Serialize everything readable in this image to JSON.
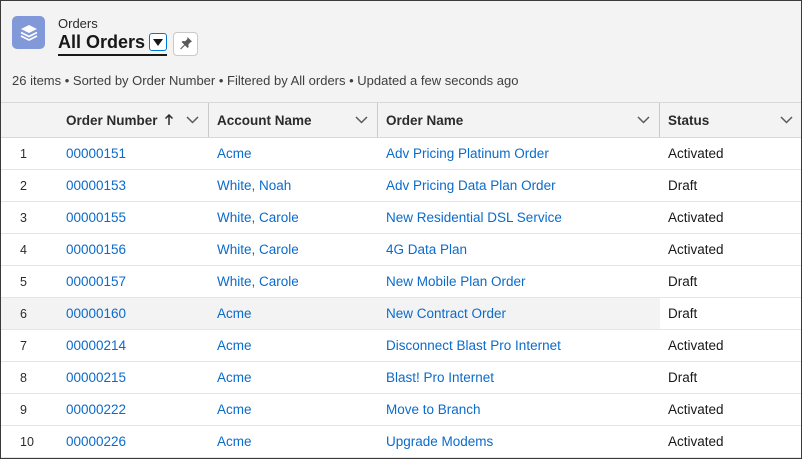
{
  "header": {
    "object_label": "Orders",
    "list_view_title": "All Orders",
    "info_line": "26 items • Sorted by Order Number • Filtered by All orders • Updated a few seconds ago",
    "icons": {
      "app": "stacked-layers-icon",
      "list_view_switcher": "caret-down-icon",
      "pin": "pin-icon"
    }
  },
  "table": {
    "columns": [
      {
        "label": "Order Number",
        "sorted": "ascending"
      },
      {
        "label": "Account Name"
      },
      {
        "label": "Order Name"
      },
      {
        "label": "Status"
      }
    ],
    "rows": [
      {
        "num": "1",
        "order_number": "00000151",
        "account": "Acme",
        "order_name": "Adv Pricing Platinum Order",
        "status": "Activated"
      },
      {
        "num": "2",
        "order_number": "00000153",
        "account": "White, Noah",
        "order_name": "Adv Pricing Data Plan Order",
        "status": "Draft"
      },
      {
        "num": "3",
        "order_number": "00000155",
        "account": "White, Carole",
        "order_name": "New Residential DSL Service",
        "status": "Activated"
      },
      {
        "num": "4",
        "order_number": "00000156",
        "account": "White, Carole",
        "order_name": "4G Data Plan",
        "status": "Activated"
      },
      {
        "num": "5",
        "order_number": "00000157",
        "account": "White, Carole",
        "order_name": "New Mobile Plan Order",
        "status": "Draft"
      },
      {
        "num": "6",
        "order_number": "00000160",
        "account": "Acme",
        "order_name": "New Contract Order",
        "status": "Draft"
      },
      {
        "num": "7",
        "order_number": "00000214",
        "account": "Acme",
        "order_name": "Disconnect Blast Pro Internet",
        "status": "Activated"
      },
      {
        "num": "8",
        "order_number": "00000215",
        "account": "Acme",
        "order_name": "Blast! Pro Internet",
        "status": "Draft"
      },
      {
        "num": "9",
        "order_number": "00000222",
        "account": "Acme",
        "order_name": "Move to Branch",
        "status": "Activated"
      },
      {
        "num": "10",
        "order_number": "00000226",
        "account": "Acme",
        "order_name": "Upgrade Modems",
        "status": "Activated"
      }
    ]
  },
  "colors": {
    "link": "#0b6bcb",
    "header_bg": "#f3f3f3",
    "app_icon_bg": "#8199d8",
    "accent": "#0176d3"
  }
}
